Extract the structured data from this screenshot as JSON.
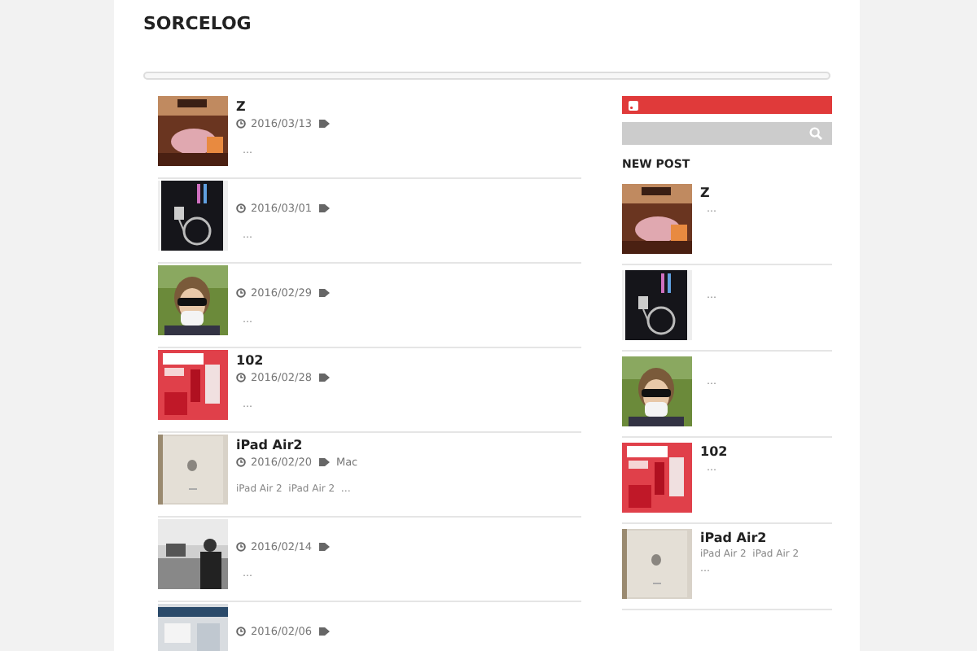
{
  "site_title": "SORCELOG",
  "posts": [
    {
      "title": "Z",
      "date": "2016/03/13",
      "excerpt": "…"
    },
    {
      "date": "2016/03/01",
      "excerpt": "…"
    },
    {
      "date": "2016/02/29",
      "excerpt": "…"
    },
    {
      "title": "102",
      "date": "2016/02/28",
      "excerpt": "…"
    },
    {
      "title": "iPad Air2",
      "date": "2016/02/20",
      "tag": "Mac",
      "excerpt": "iPad Air 2  iPad Air 2  …"
    },
    {
      "date": "2016/02/14",
      "excerpt": "…"
    },
    {
      "date": "2016/02/06"
    }
  ],
  "sidebar": {
    "new_post_heading": "NEW POST",
    "new_posts": [
      {
        "title": "Z",
        "excerpt": "…"
      },
      {
        "excerpt": "…"
      },
      {
        "excerpt": "…"
      },
      {
        "title": "102",
        "excerpt": "…"
      },
      {
        "title": "iPad Air2",
        "excerpt": "iPad Air 2  iPad Air 2",
        "excerpt2": "…"
      }
    ]
  }
}
